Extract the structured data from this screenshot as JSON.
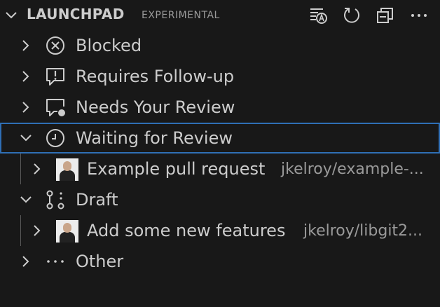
{
  "header": {
    "title": "LAUNCHPAD",
    "badge": "EXPERIMENTAL",
    "icons": [
      "filter-icon",
      "refresh-icon",
      "collapse-all-icon",
      "more-icon"
    ]
  },
  "tree": {
    "blocked": {
      "label": "Blocked",
      "icon": "circle-x-icon"
    },
    "follow_up": {
      "label": "Requires Follow-up",
      "icon": "comment-alert-icon"
    },
    "needs_review": {
      "label": "Needs Your Review",
      "icon": "comment-unresolved-icon"
    },
    "waiting": {
      "label": "Waiting for Review",
      "icon": "clock-circle-icon"
    },
    "waiting_child": {
      "label": "Example pull request",
      "desc": "jkelroy/example-..."
    },
    "draft": {
      "label": "Draft",
      "icon": "git-pull-request-draft-icon"
    },
    "draft_child": {
      "label": "Add some new features",
      "desc": "jkelroy/libgit2..."
    },
    "other": {
      "label": "Other",
      "icon": "ellipsis-icon"
    }
  },
  "colors": {
    "background": "#181818",
    "text": "#cccccc",
    "muted": "#9a9a9a",
    "focus_outline": "#2f6fb5"
  }
}
